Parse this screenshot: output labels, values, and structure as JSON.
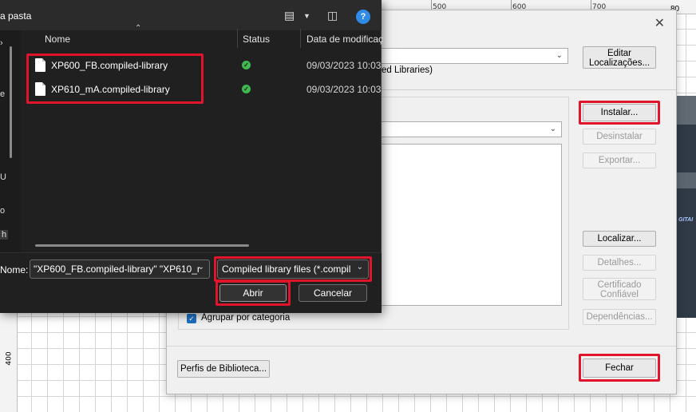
{
  "background": {
    "ruler_labels": [
      "500",
      "600",
      "700"
    ],
    "far_right_label": "80",
    "left_ruler_label": "400",
    "strip_text": "GITAI"
  },
  "file_dialog": {
    "breadcrumb": "a pasta",
    "help_label": "?",
    "nav_glyphs": [
      "e",
      "U",
      "o",
      "h"
    ],
    "columns": {
      "name": "Nome",
      "status": "Status",
      "date": "Data de modificaç"
    },
    "files": [
      {
        "name": "XP600_FB.compiled-library",
        "date": "09/03/2023 10:03"
      },
      {
        "name": "XP610_mA.compiled-library",
        "date": "09/03/2023 10:03"
      }
    ],
    "filename_label": "Nome:",
    "filename_value": "\"XP600_FB.compiled-library\" \"XP610_r",
    "filter_value": "Compiled library files (*.compil",
    "open_button": "Abrir",
    "cancel_button": "Cancelar"
  },
  "library_dialog": {
    "close_glyph": "✕",
    "edit_locations": "Editar Localizações...",
    "libraries_text": "ed Libraries)",
    "install": "Instalar...",
    "uninstall": "Desinstalar",
    "export": "Exportar...",
    "locate": "Localizar...",
    "details": "Detalhes...",
    "trusted_cert": "Certificado Confiável",
    "dependencies": "Dependências...",
    "group_by_category": "Agrupar por categoria",
    "library_profiles": "Perfis de Biblioteca...",
    "close": "Fechar"
  },
  "colors": {
    "highlight": "#e0142a",
    "dark_bg": "#202020",
    "accent_blue": "#2f8be6",
    "status_ok": "#3fb950"
  }
}
